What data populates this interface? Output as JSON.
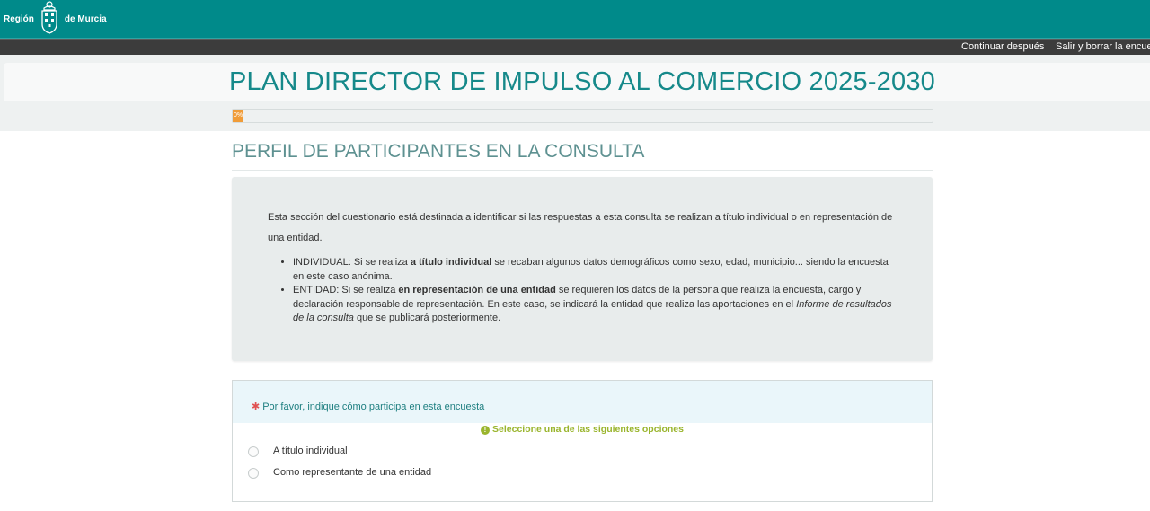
{
  "header": {
    "logo_left": "Región",
    "logo_right": "de Murcia"
  },
  "nav": {
    "continue_later": "Continuar después",
    "exit_and_clear": "Salir y borrar la encuesta"
  },
  "survey": {
    "title": "PLAN DIRECTOR DE IMPULSO AL COMERCIO 2025-2030",
    "progress_label": "0%",
    "progress_value": 0
  },
  "section": {
    "title": "PERFIL DE PARTICIPANTES EN LA CONSULTA",
    "intro": "Esta sección del cuestionario está destinada a identificar si las respuestas a esta consulta se realizan a título individual o en representación de una entidad.",
    "items": [
      {
        "before": "INDIVIDUAL: Si se realiza ",
        "bold": "a título individual",
        "after": " se recaban algunos datos demográficos como sexo, edad, municipio... siendo la encuesta en este caso anónima."
      },
      {
        "before": "ENTIDAD: Si se realiza ",
        "bold": "en representación de una entidad",
        "middle": " se requieren los datos de la persona que realiza la encuesta, cargo y declaración responsable de representación. En este caso, se indicará la entidad que realiza las aportaciones en el ",
        "italic": "Informe de resultados de la consulta",
        "after": " que se publicará posteriormente."
      }
    ]
  },
  "question": {
    "required_mark": "✱",
    "text": "Por favor, indique cómo participa en esta encuesta",
    "tip": "Seleccione una de las siguientes opciones",
    "options": [
      "A título individual",
      "Como representante de una entidad"
    ]
  },
  "colors": {
    "header_teal": "#008a8a",
    "title_teal": "#16898a",
    "progress_orange": "#f09c38",
    "tip_green": "#9ab52d",
    "required_red": "#e05252"
  }
}
